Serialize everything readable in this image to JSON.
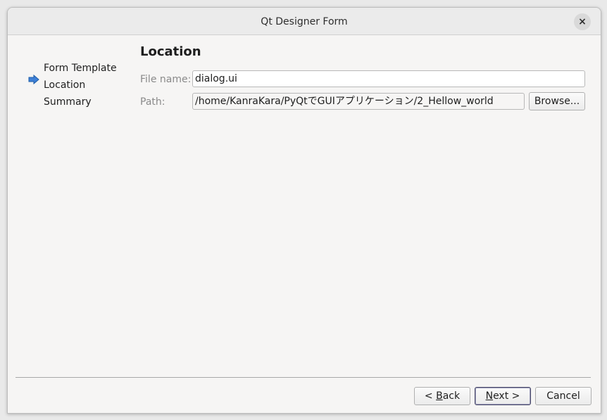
{
  "window": {
    "title": "Qt Designer Form",
    "close_icon": "×"
  },
  "steps": [
    {
      "label": "Form Template",
      "current": false
    },
    {
      "label": "Location",
      "current": true
    },
    {
      "label": "Summary",
      "current": false
    }
  ],
  "page": {
    "title": "Location",
    "file_name_label": "File name:",
    "file_name_value": "dialog.ui",
    "path_label": "Path:",
    "path_value": "/home/KanraKara/PyQtでGUIアプリケーション/2_Hellow_world",
    "browse_label": "Browse..."
  },
  "buttons": {
    "back_mnemonic": "B",
    "back_rest": "ack",
    "next_mnemonic": "N",
    "next_rest": "ext",
    "cancel": "Cancel"
  },
  "colors": {
    "arrow": "#3d7fd6",
    "default_button_border": "#4a4a6a"
  }
}
